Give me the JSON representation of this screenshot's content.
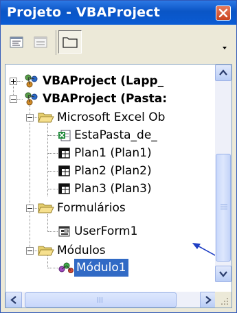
{
  "window": {
    "title": "Projeto - VBAProject",
    "accent": "#0b5cd4"
  },
  "toolbar": {
    "buttons": [
      {
        "name": "view-code",
        "icon": "view-code-icon"
      },
      {
        "name": "view-object",
        "icon": "view-object-icon"
      },
      {
        "name": "toggle-folders",
        "icon": "folder-icon"
      }
    ]
  },
  "tree": {
    "items": [
      {
        "label": "VBAProject (Lapp_",
        "bold": true,
        "icon": "vba-project-icon",
        "expander": "plus"
      },
      {
        "label": "VBAProject (Pasta:",
        "bold": true,
        "icon": "vba-project-icon",
        "expander": "minus"
      },
      {
        "label": "Microsoft Excel Ob",
        "icon": "folder-open-icon",
        "expander": "minus"
      },
      {
        "label": "EstaPasta_de_",
        "icon": "excel-workbook-icon"
      },
      {
        "label": "Plan1 (Plan1)",
        "icon": "worksheet-icon"
      },
      {
        "label": "Plan2 (Plan2)",
        "icon": "worksheet-icon"
      },
      {
        "label": "Plan3 (Plan3)",
        "icon": "worksheet-icon"
      },
      {
        "label": "Formulários",
        "icon": "folder-open-icon",
        "expander": "minus"
      },
      {
        "label": "UserForm1",
        "icon": "userform-icon"
      },
      {
        "label": "Módulos",
        "icon": "folder-open-icon",
        "expander": "minus"
      },
      {
        "label": "Módulo1",
        "icon": "module-icon",
        "selected": true
      }
    ]
  },
  "selection_color": "#316ac5"
}
